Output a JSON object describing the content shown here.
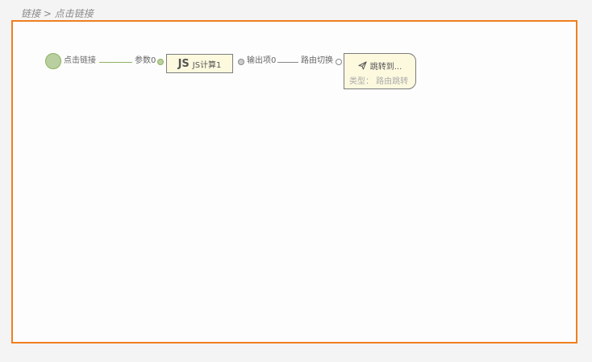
{
  "breadcrumb": "链接 > 点击链接",
  "flow": {
    "start": {
      "label": "点击链接"
    },
    "param_port": {
      "label": "参数0"
    },
    "js_node": {
      "icon_text": "JS",
      "icon": "js-icon",
      "label": "JS计算1"
    },
    "output_port": {
      "label": "输出项0"
    },
    "route_port": {
      "label": "路由切换"
    },
    "jump_node": {
      "icon": "paper-plane-icon",
      "title": "跳转到...",
      "subtitle": "类型：  路由跳转"
    }
  },
  "colors": {
    "canvas_border": "#f07f1e",
    "start_fill": "#b9cfa0",
    "green_line": "#8eb25f",
    "node_fill": "#fdf9df"
  }
}
